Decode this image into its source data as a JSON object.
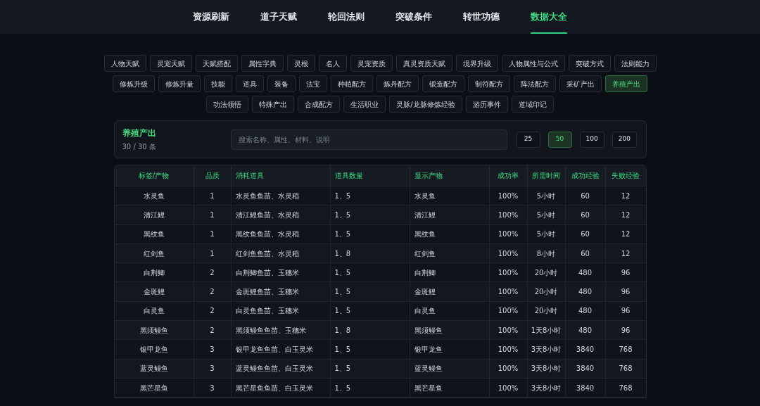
{
  "nav_tabs": [
    {
      "label": "资源刷新",
      "selected": false
    },
    {
      "label": "道子天赋",
      "selected": false
    },
    {
      "label": "轮回法则",
      "selected": false
    },
    {
      "label": "突破条件",
      "selected": false
    },
    {
      "label": "转世功德",
      "selected": false
    },
    {
      "label": "数据大全",
      "selected": true
    }
  ],
  "categories": [
    [
      {
        "label": "人物天赋",
        "selected": false
      },
      {
        "label": "灵宠天赋",
        "selected": false
      },
      {
        "label": "天赋搭配",
        "selected": false
      },
      {
        "label": "属性字典",
        "selected": false
      },
      {
        "label": "灵根",
        "selected": false
      },
      {
        "label": "名人",
        "selected": false
      },
      {
        "label": "灵宠资质",
        "selected": false
      },
      {
        "label": "真灵资质天赋",
        "selected": false
      },
      {
        "label": "境界升级",
        "selected": false
      },
      {
        "label": "人物属性与公式",
        "selected": false
      },
      {
        "label": "突破方式",
        "selected": false
      },
      {
        "label": "法则能力",
        "selected": false
      }
    ],
    [
      {
        "label": "修炼升级",
        "selected": false
      },
      {
        "label": "修炼升量",
        "selected": false
      },
      {
        "label": "技能",
        "selected": false
      },
      {
        "label": "道具",
        "selected": false
      },
      {
        "label": "装备",
        "selected": false
      },
      {
        "label": "法宝",
        "selected": false
      },
      {
        "label": "种植配方",
        "selected": false
      },
      {
        "label": "炼丹配方",
        "selected": false
      },
      {
        "label": "锻造配方",
        "selected": false
      },
      {
        "label": "制符配方",
        "selected": false
      },
      {
        "label": "阵法配方",
        "selected": false
      },
      {
        "label": "采矿产出",
        "selected": false
      },
      {
        "label": "养殖产出",
        "selected": true
      }
    ],
    [
      {
        "label": "功法领悟",
        "selected": false
      },
      {
        "label": "特殊产出",
        "selected": false
      },
      {
        "label": "合成配方",
        "selected": false
      },
      {
        "label": "生活职业",
        "selected": false
      },
      {
        "label": "灵脉/龙脉修炼经验",
        "selected": false
      },
      {
        "label": "游历事件",
        "selected": false
      },
      {
        "label": "道域印记",
        "selected": false
      }
    ]
  ],
  "panel": {
    "title": "养殖产出",
    "count": "30 / 30 条",
    "search": {
      "placeholder": "搜索名称、属性、材料、说明"
    },
    "page_sizes": [
      {
        "label": "25",
        "selected": false
      },
      {
        "label": "50",
        "selected": true
      },
      {
        "label": "100",
        "selected": false
      },
      {
        "label": "200",
        "selected": false
      }
    ]
  },
  "table": {
    "columns": [
      "标签/产物",
      "品质",
      "消耗道具",
      "道具数量",
      "显示产物",
      "成功率",
      "所需时间",
      "成功经验",
      "失败经验"
    ],
    "rows": [
      [
        "水灵鱼",
        "1",
        "水灵鱼鱼苗、水灵稻",
        "1、5",
        "水灵鱼",
        "100%",
        "5小时",
        "60",
        "12"
      ],
      [
        "清江鲤",
        "1",
        "清江鲤鱼苗、水灵稻",
        "1、5",
        "清江鲤",
        "100%",
        "5小时",
        "60",
        "12"
      ],
      [
        "黑纹鱼",
        "1",
        "黑纹鱼鱼苗、水灵稻",
        "1、5",
        "黑纹鱼",
        "100%",
        "5小时",
        "60",
        "12"
      ],
      [
        "红剑鱼",
        "1",
        "红剑鱼鱼苗、水灵稻",
        "1、8",
        "红剑鱼",
        "100%",
        "8小时",
        "60",
        "12"
      ],
      [
        "白荆鲫",
        "2",
        "白荆鲫鱼苗、玉穗米",
        "1、5",
        "白荆鲫",
        "100%",
        "20小时",
        "480",
        "96"
      ],
      [
        "金斑鲤",
        "2",
        "金斑鲤鱼苗、玉穗米",
        "1、5",
        "金斑鲤",
        "100%",
        "20小时",
        "480",
        "96"
      ],
      [
        "白灵鱼",
        "2",
        "白灵鱼鱼苗、玉穗米",
        "1、5",
        "白灵鱼",
        "100%",
        "20小时",
        "480",
        "96"
      ],
      [
        "黑须鳗鱼",
        "2",
        "黑须鳗鱼鱼苗、玉穗米",
        "1、8",
        "黑须鳗鱼",
        "100%",
        "1天8小时",
        "480",
        "96"
      ],
      [
        "银甲龙鱼",
        "3",
        "银甲龙鱼鱼苗、白玉灵米",
        "1、5",
        "银甲龙鱼",
        "100%",
        "3天8小时",
        "3840",
        "768"
      ],
      [
        "蓝灵鳗鱼",
        "3",
        "蓝灵鳗鱼鱼苗、白玉灵米",
        "1、5",
        "蓝灵鳗鱼",
        "100%",
        "3天8小时",
        "3840",
        "768"
      ],
      [
        "黑芒星鱼",
        "3",
        "黑芒星鱼鱼苗、白玉灵米",
        "1、5",
        "黑芒星鱼",
        "100%",
        "3天8小时",
        "3840",
        "768"
      ]
    ]
  }
}
